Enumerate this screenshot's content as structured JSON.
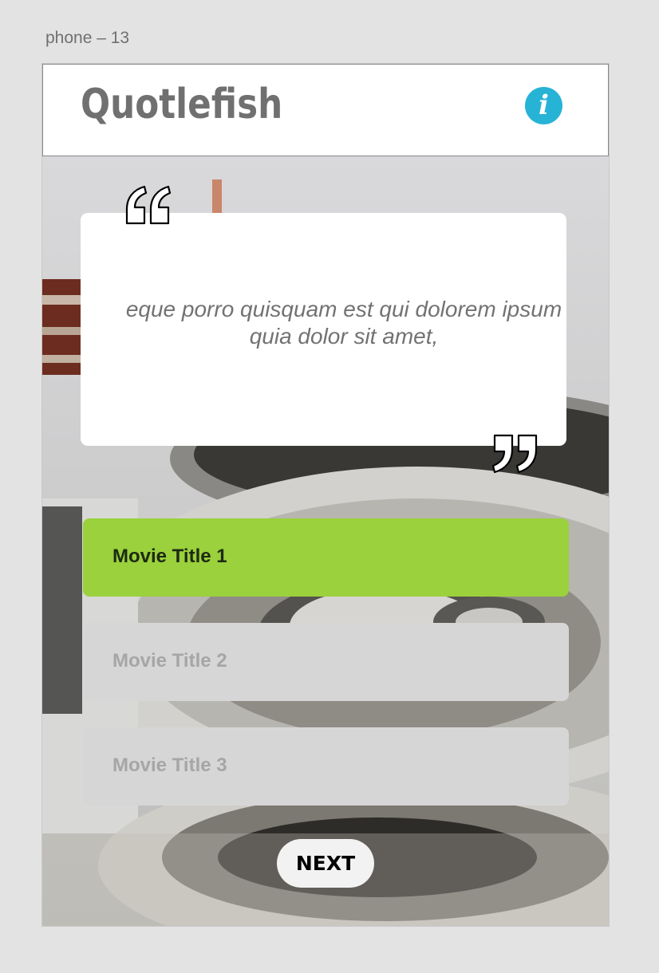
{
  "artboard": {
    "label": "phone – 13"
  },
  "header": {
    "app_title": "Quotlefish",
    "info_icon": "info-icon",
    "info_glyph": "i",
    "info_color": "#27b3d6"
  },
  "background": {
    "image": "film-reels-photo"
  },
  "quote": {
    "text": "eque porro quisquam est qui dolorem ipsum quia dolor sit amet,",
    "open_icon": "open-quote-icon",
    "close_icon": "close-quote-icon"
  },
  "options": [
    {
      "label": "Movie Title 1",
      "state": "selected",
      "color": "#9ad13c"
    },
    {
      "label": "Movie Title 2",
      "state": "unselected",
      "color": "#d6d6d6"
    },
    {
      "label": "Movie Title 3",
      "state": "unselected",
      "color": "#d6d6d6"
    }
  ],
  "next_button": {
    "label": "NEXT"
  }
}
